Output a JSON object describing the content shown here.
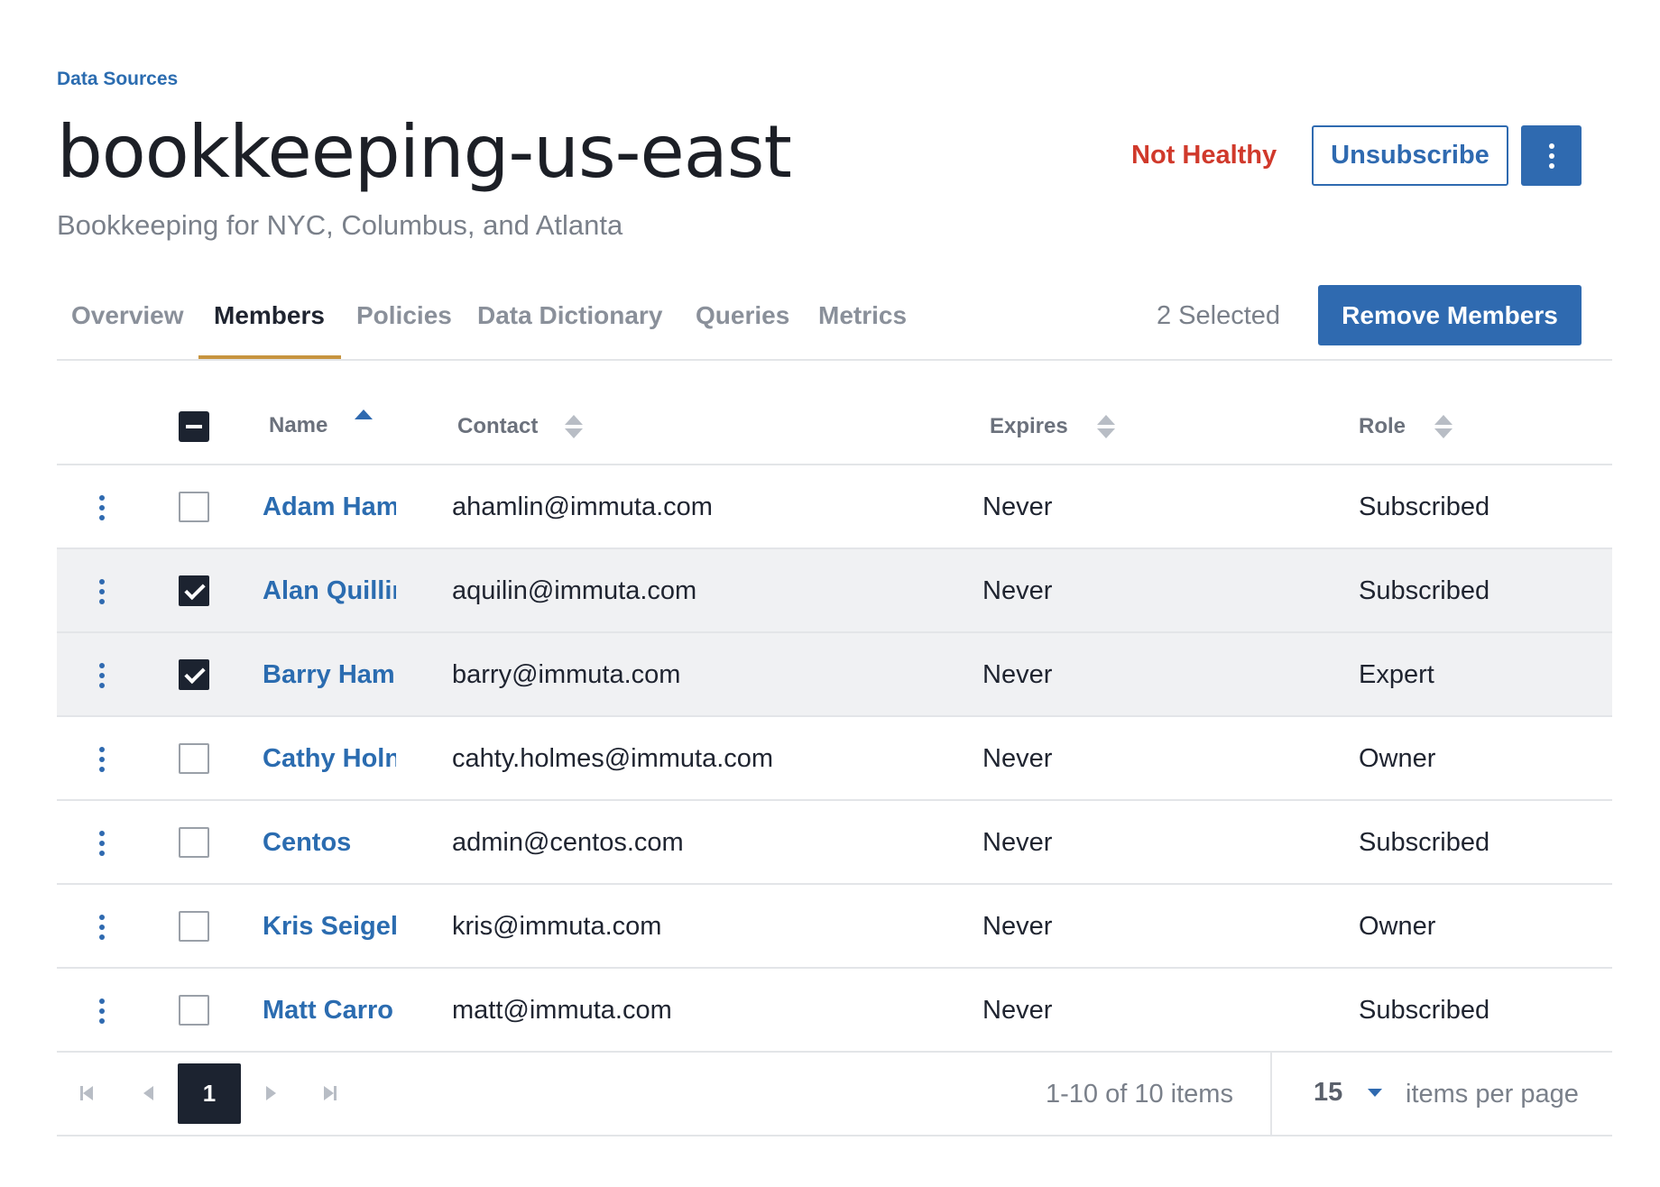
{
  "breadcrumb": "Data Sources",
  "title": "bookkeeping-us-east",
  "subtitle": "Bookkeeping for NYC, Columbus, and Atlanta",
  "header": {
    "health_status": "Not Healthy",
    "unsubscribe_label": "Unsubscribe",
    "more_icon": "kebab-vertical-icon"
  },
  "tabs": [
    {
      "label": "Overview",
      "active": false
    },
    {
      "label": "Members",
      "active": true
    },
    {
      "label": "Policies",
      "active": false
    },
    {
      "label": "Data Dictionary",
      "active": false
    },
    {
      "label": "Queries",
      "active": false
    },
    {
      "label": "Metrics",
      "active": false
    }
  ],
  "selection": {
    "count_label": "2 Selected",
    "remove_label": "Remove Members"
  },
  "table": {
    "columns": [
      {
        "label": "Name",
        "sort": "asc"
      },
      {
        "label": "Contact",
        "sort": "none"
      },
      {
        "label": "Expires",
        "sort": "none"
      },
      {
        "label": "Role",
        "sort": "none"
      }
    ],
    "rows": [
      {
        "name": "Adam Ham",
        "contact": "ahamlin@immuta.com",
        "expires": "Never",
        "role": "Subscribed",
        "checked": false
      },
      {
        "name": "Alan Quillir",
        "contact": "aquilin@immuta.com",
        "expires": "Never",
        "role": "Subscribed",
        "checked": true
      },
      {
        "name": "Barry Hami",
        "contact": "barry@immuta.com",
        "expires": "Never",
        "role": "Expert",
        "checked": true
      },
      {
        "name": "Cathy Holn",
        "contact": "cahty.holmes@immuta.com",
        "expires": "Never",
        "role": "Owner",
        "checked": false
      },
      {
        "name": "Centos",
        "contact": "admin@centos.com",
        "expires": "Never",
        "role": "Subscribed",
        "checked": false
      },
      {
        "name": "Kris Seigel",
        "contact": "kris@immuta.com",
        "expires": "Never",
        "role": "Owner",
        "checked": false
      },
      {
        "name": "Matt Carro",
        "contact": "matt@immuta.com",
        "expires": "Never",
        "role": "Subscribed",
        "checked": false
      }
    ]
  },
  "pagination": {
    "current_page": "1",
    "info": "1-10 of 10 items",
    "per_page": "15",
    "per_page_label": "items per page"
  },
  "colors": {
    "accent": "#2f6ab0",
    "link": "#2b6cb0",
    "danger": "#d0392b",
    "tab_underline": "#c7943f",
    "dark": "#1c2330"
  }
}
